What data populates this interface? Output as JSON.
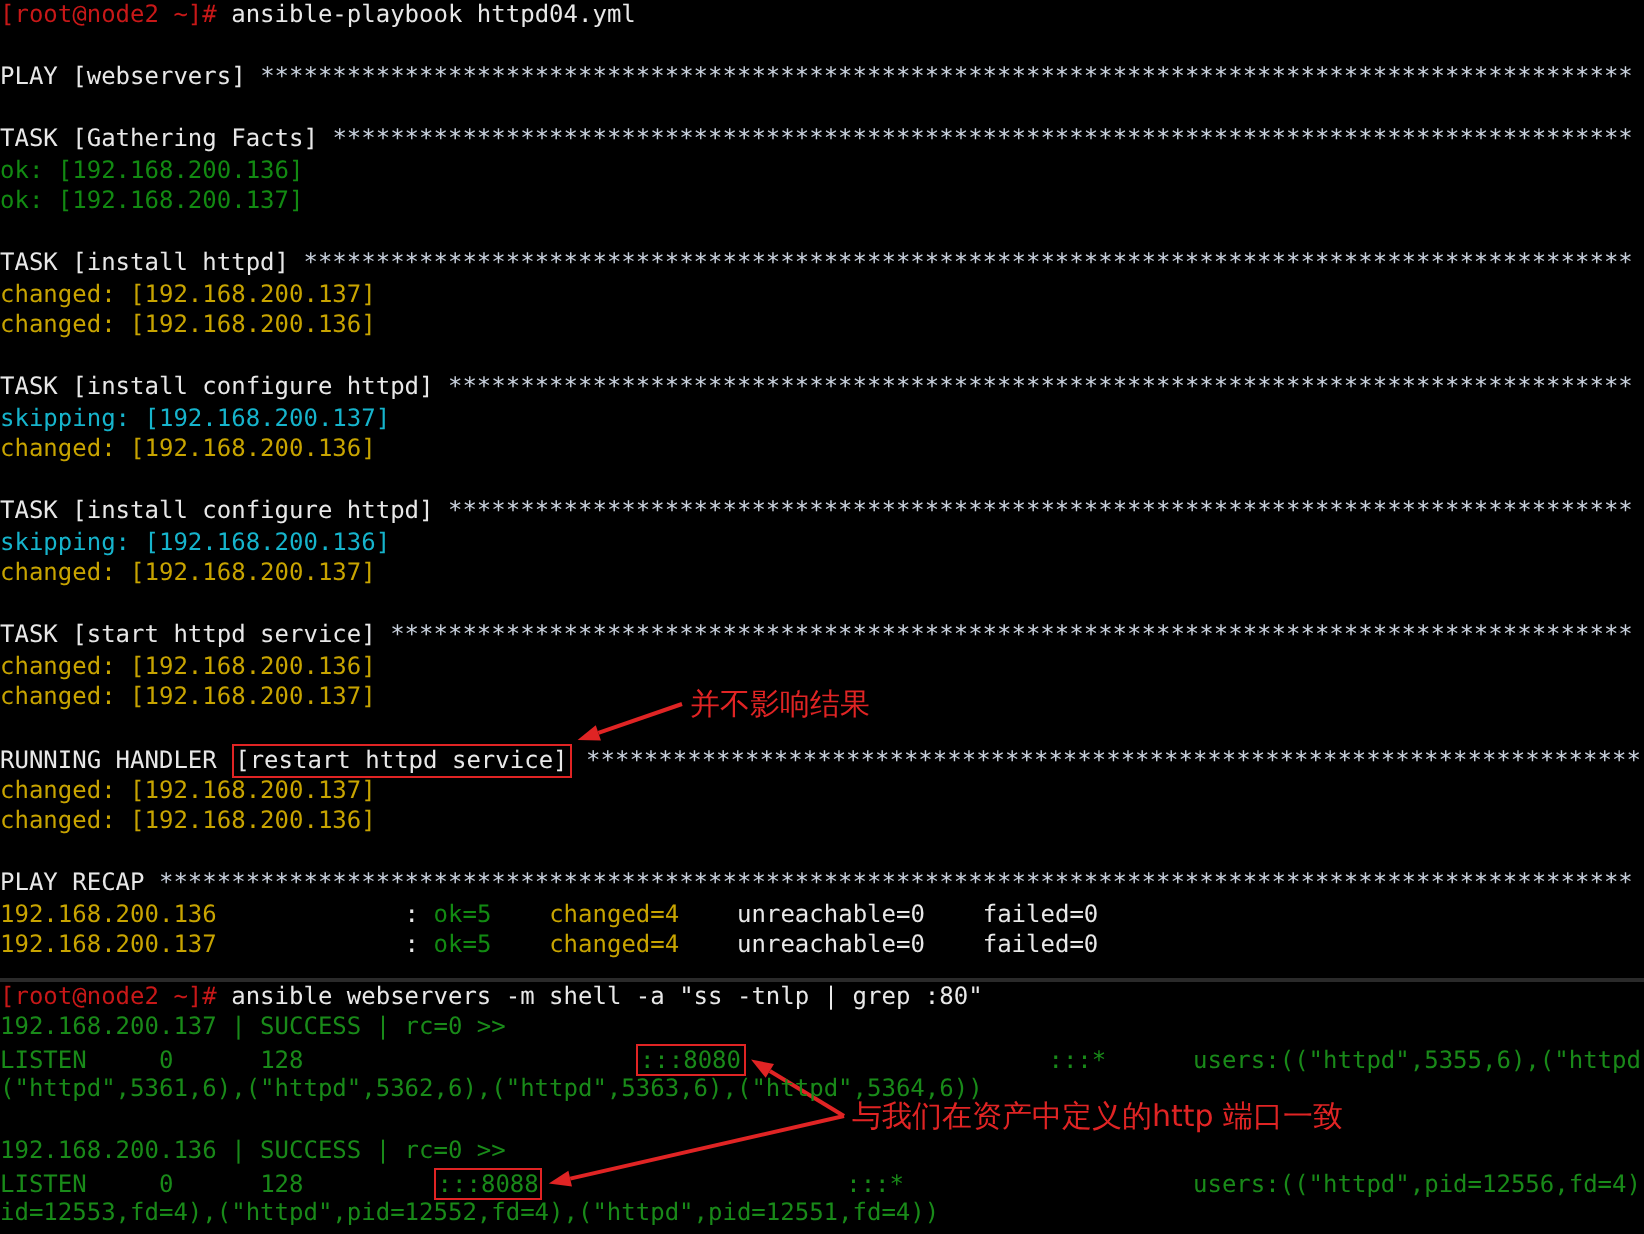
{
  "terminal_sessions": [
    {
      "lines": [
        {
          "kind": "text",
          "segments": [
            {
              "kind": "prompt",
              "text": "[root@node2 ~]#"
            },
            {
              "kind": "plain",
              "text": " ansible-playbook httpd04.yml"
            }
          ]
        },
        {
          "kind": "blank"
        },
        {
          "kind": "text",
          "segments": [
            {
              "kind": "plain",
              "text": "PLAY [webservers]"
            },
            {
              "kind": "stars",
              "text": " ***********************************************************************************************"
            }
          ]
        },
        {
          "kind": "blank"
        },
        {
          "kind": "text",
          "segments": [
            {
              "kind": "plain",
              "text": "TASK [Gathering Facts]"
            },
            {
              "kind": "stars",
              "text": " ******************************************************************************************"
            }
          ]
        },
        {
          "kind": "text",
          "segments": [
            {
              "kind": "ok",
              "text": "ok: [192.168.200.136]"
            }
          ]
        },
        {
          "kind": "text",
          "segments": [
            {
              "kind": "ok",
              "text": "ok: [192.168.200.137]"
            }
          ]
        },
        {
          "kind": "blank"
        },
        {
          "kind": "text",
          "segments": [
            {
              "kind": "plain",
              "text": "TASK [install httpd]"
            },
            {
              "kind": "stars",
              "text": " ********************************************************************************************"
            }
          ]
        },
        {
          "kind": "text",
          "segments": [
            {
              "kind": "changed",
              "text": "changed: [192.168.200.137]"
            }
          ]
        },
        {
          "kind": "text",
          "segments": [
            {
              "kind": "changed",
              "text": "changed: [192.168.200.136]"
            }
          ]
        },
        {
          "kind": "blank"
        },
        {
          "kind": "text",
          "segments": [
            {
              "kind": "plain",
              "text": "TASK [install configure httpd]"
            },
            {
              "kind": "stars",
              "text": " **********************************************************************************"
            }
          ]
        },
        {
          "kind": "text",
          "segments": [
            {
              "kind": "skipping",
              "text": "skipping: [192.168.200.137]"
            }
          ]
        },
        {
          "kind": "text",
          "segments": [
            {
              "kind": "changed",
              "text": "changed: [192.168.200.136]"
            }
          ]
        },
        {
          "kind": "blank"
        },
        {
          "kind": "text",
          "segments": [
            {
              "kind": "plain",
              "text": "TASK [install configure httpd]"
            },
            {
              "kind": "stars",
              "text": " **********************************************************************************"
            }
          ]
        },
        {
          "kind": "text",
          "segments": [
            {
              "kind": "skipping",
              "text": "skipping: [192.168.200.136]"
            }
          ]
        },
        {
          "kind": "text",
          "segments": [
            {
              "kind": "changed",
              "text": "changed: [192.168.200.137]"
            }
          ]
        },
        {
          "kind": "blank"
        },
        {
          "kind": "text",
          "segments": [
            {
              "kind": "plain",
              "text": "TASK [start httpd service]"
            },
            {
              "kind": "stars",
              "text": " **************************************************************************************"
            }
          ]
        },
        {
          "kind": "text",
          "segments": [
            {
              "kind": "changed",
              "text": "changed: [192.168.200.136]"
            }
          ]
        },
        {
          "kind": "text",
          "segments": [
            {
              "kind": "changed",
              "text": "changed: [192.168.200.137]"
            }
          ]
        },
        {
          "kind": "blank"
        },
        {
          "kind": "text",
          "segments": [
            {
              "kind": "plain",
              "text": "RUNNING HANDLER"
            },
            {
              "kind": "plain",
              "text": " [restart httpd service]",
              "boxed": true
            },
            {
              "kind": "stars",
              "text": " *************************************************************************"
            }
          ]
        },
        {
          "kind": "text",
          "segments": [
            {
              "kind": "changed",
              "text": "changed: [192.168.200.137]"
            }
          ]
        },
        {
          "kind": "text",
          "segments": [
            {
              "kind": "changed",
              "text": "changed: [192.168.200.136]"
            }
          ]
        },
        {
          "kind": "blank"
        },
        {
          "kind": "text",
          "segments": [
            {
              "kind": "plain",
              "text": "PLAY RECAP"
            },
            {
              "kind": "stars",
              "text": " ******************************************************************************************************"
            }
          ]
        },
        {
          "kind": "text",
          "segments": [
            {
              "kind": "changed",
              "text": "192.168.200.136"
            },
            {
              "kind": "plain",
              "text": "             :"
            },
            {
              "kind": "ok",
              "text": " ok=5"
            },
            {
              "kind": "changed",
              "text": "    changed=4"
            },
            {
              "kind": "plain",
              "text": "    unreachable=0"
            },
            {
              "kind": "plain",
              "text": "    failed=0"
            }
          ]
        },
        {
          "kind": "text",
          "segments": [
            {
              "kind": "changed",
              "text": "192.168.200.137"
            },
            {
              "kind": "plain",
              "text": "             :"
            },
            {
              "kind": "ok",
              "text": " ok=5"
            },
            {
              "kind": "changed",
              "text": "    changed=4"
            },
            {
              "kind": "plain",
              "text": "    unreachable=0"
            },
            {
              "kind": "plain",
              "text": "    failed=0"
            }
          ]
        }
      ]
    },
    {
      "lines": [
        {
          "kind": "text",
          "segments": [
            {
              "kind": "prompt",
              "text": "[root@node2 ~]#"
            },
            {
              "kind": "plain",
              "text": " ansible webservers -m shell -a \"ss -tnlp | grep :80\""
            }
          ]
        },
        {
          "kind": "text",
          "segments": [
            {
              "kind": "output",
              "text": "192.168.200.137 | SUCCESS | rc=0 >>"
            }
          ]
        },
        {
          "kind": "text",
          "segments": [
            {
              "kind": "output",
              "text": "LISTEN"
            },
            {
              "kind": "output",
              "text": "     0"
            },
            {
              "kind": "output",
              "text": "      128"
            },
            {
              "kind": "output",
              "text": "                       :::8080",
              "boxed": true
            },
            {
              "kind": "output",
              "text": "                     :::*"
            },
            {
              "kind": "output",
              "text": "      users:((\"httpd\",5355,6),(\"httpd"
            }
          ]
        },
        {
          "kind": "text",
          "segments": [
            {
              "kind": "output",
              "text": "(\"httpd\",5361,6),(\"httpd\",5362,6),(\"httpd\",5363,6),"
            },
            {
              "kind": "output",
              "text": "(\"httpd\",5364,6))"
            }
          ]
        },
        {
          "kind": "blank"
        },
        {
          "kind": "text",
          "segments": [
            {
              "kind": "output",
              "text": "192.168.200.136 | SUCCESS | rc=0 >>"
            }
          ]
        },
        {
          "kind": "text",
          "segments": [
            {
              "kind": "output",
              "text": "LISTEN"
            },
            {
              "kind": "output",
              "text": "     0"
            },
            {
              "kind": "output",
              "text": "      128"
            },
            {
              "kind": "output",
              "text": "         :::8088",
              "boxed": true
            },
            {
              "kind": "output",
              "text": "                     :::*"
            },
            {
              "kind": "output",
              "text": "                    users:((\"httpd\",pid=12556,fd=4)"
            }
          ]
        },
        {
          "kind": "text",
          "segments": [
            {
              "kind": "output",
              "text": "id=12553,fd=4),(\"httpd\",pid=12552,fd=4),(\"httpd\",pid=12551,fd=4))"
            }
          ]
        }
      ]
    }
  ],
  "annotations": [
    {
      "text": "并不影响结果"
    },
    {
      "text": "与我们在资产中定义的http 端口一致"
    }
  ]
}
